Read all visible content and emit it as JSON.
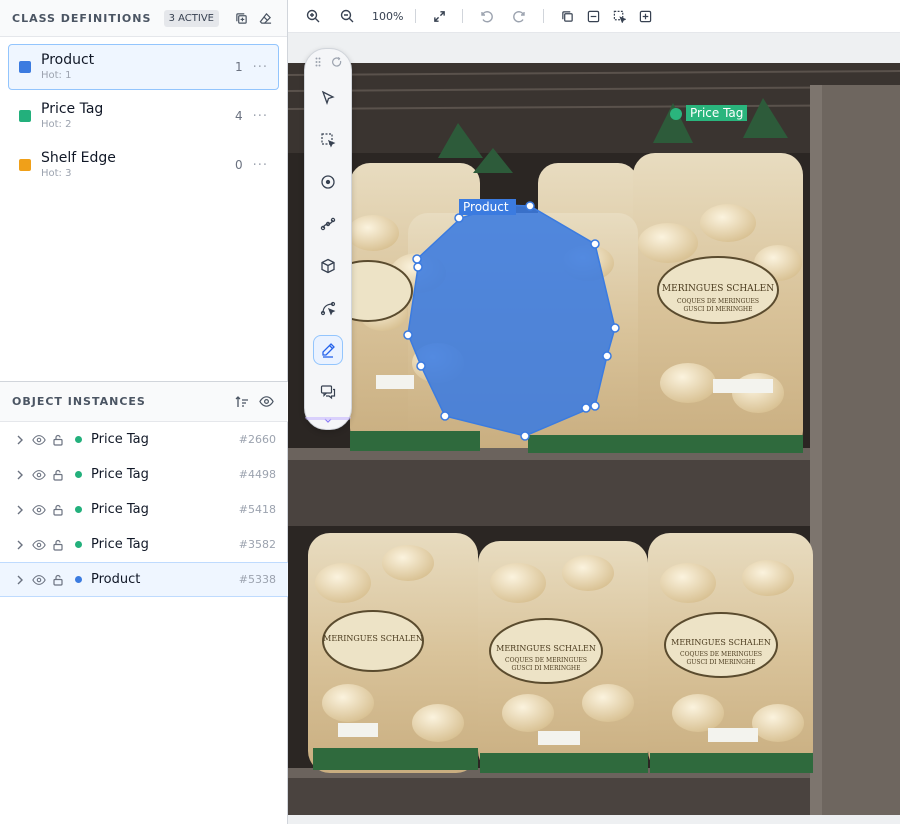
{
  "class_definitions": {
    "title": "CLASS DEFINITIONS",
    "active_badge": "3 ACTIVE",
    "items": [
      {
        "name": "Product",
        "hotkey": "Hot: 1",
        "count": "1",
        "color": "#3b7be0",
        "selected": true
      },
      {
        "name": "Price Tag",
        "hotkey": "Hot: 2",
        "count": "4",
        "color": "#23b07c",
        "selected": false
      },
      {
        "name": "Shelf Edge",
        "hotkey": "Hot: 3",
        "count": "0",
        "color": "#f0a019",
        "selected": false
      }
    ],
    "more_glyph": "···"
  },
  "object_instances": {
    "title": "OBJECT INSTANCES",
    "items": [
      {
        "label": "Price Tag",
        "id": "#2660",
        "color": "#23b07c"
      },
      {
        "label": "Price Tag",
        "id": "#4498",
        "color": "#23b07c"
      },
      {
        "label": "Price Tag",
        "id": "#5418",
        "color": "#23b07c"
      },
      {
        "label": "Price Tag",
        "id": "#3582",
        "color": "#23b07c"
      },
      {
        "label": "Product",
        "id": "#5338",
        "color": "#3b7be0",
        "selected": true
      }
    ]
  },
  "toolbar": {
    "zoom_level": "100%",
    "buttons": [
      "zoom-in-icon",
      "zoom-out-icon",
      "fit-screen-icon",
      "undo-icon",
      "redo-icon",
      "copy-icon",
      "minus-square-icon",
      "select-area-icon",
      "add-square-icon"
    ]
  },
  "tool_palette": {
    "tools": [
      "pointer-icon",
      "box-select-icon",
      "point-icon",
      "polyline-icon",
      "cuboid-icon",
      "path-icon",
      "pen-icon",
      "comment-icon"
    ],
    "active_tool": "pen-icon"
  },
  "annotations": {
    "price_tag_label": "Price Tag",
    "product_label": "Product"
  },
  "photo_text": {
    "brand": "MERINGUES SCHALEN",
    "line1": "COQUES DE MERINGUES",
    "line2": "GUSCI DI MERINGHE"
  },
  "colors": {
    "product": "#3b7be0",
    "price_tag": "#23b07c",
    "shelf_edge": "#f0a019",
    "accent": "#2563eb"
  }
}
